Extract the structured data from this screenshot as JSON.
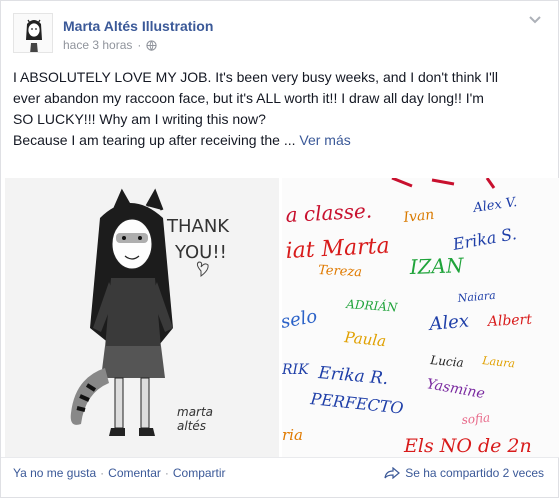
{
  "post": {
    "page_name": "Marta Altés Illustration",
    "time": "hace 3 horas",
    "line1": "I ABSOLUTELY LOVE MY JOB. It's been very busy weeks, and I don't think I'll",
    "line2": "ever abandon my raccoon face, but it's ALL worth it!! I draw all day long!! I'm",
    "line3": "SO LUCKY!!! Why am I writing this now?",
    "line4": "Because I am tearing up after receiving the ...",
    "see_more": "Ver más"
  },
  "photo_left": {
    "speech1": "THANK",
    "speech2": "YOU!!",
    "signature1": "marta",
    "signature2": "altés"
  },
  "photo_right": {
    "words": [
      {
        "text": "a classe.",
        "color": "#c8102e"
      },
      {
        "text": "Ivan",
        "color": "#d97a00"
      },
      {
        "text": "Alex V.",
        "color": "#1f3fa8"
      },
      {
        "text": "iat Marta",
        "color": "#d81b1b"
      },
      {
        "text": "Erika S.",
        "color": "#1f3fa8"
      },
      {
        "text": "IZAN",
        "color": "#1fa33a"
      },
      {
        "text": "Tereza",
        "color": "#e07a00"
      },
      {
        "text": "ADRIÁN",
        "color": "#1fa33a"
      },
      {
        "text": "Naiara",
        "color": "#1f3fa8"
      },
      {
        "text": "Alex",
        "color": "#1f3fa8"
      },
      {
        "text": "Albert",
        "color": "#d81b1b"
      },
      {
        "text": "Paula",
        "color": "#e0a000"
      },
      {
        "text": "Lucia",
        "color": "#222222"
      },
      {
        "text": "Laura",
        "color": "#e0a000"
      },
      {
        "text": "Erika R.",
        "color": "#1f3fa8"
      },
      {
        "text": "Yasmine",
        "color": "#7a2aa0"
      },
      {
        "text": "PERFECTO",
        "color": "#1f3fa8"
      },
      {
        "text": "ria",
        "color": "#e07a00"
      },
      {
        "text": "Els NO de 2n",
        "color": "#d81b1b"
      },
      {
        "text": "sofia",
        "color": "#e86a8a"
      },
      {
        "text": "selo",
        "color": "#2b62c8"
      },
      {
        "text": "RIK",
        "color": "#1f3fa8"
      }
    ]
  },
  "footer": {
    "unlike": "Ya no me gusta",
    "comment": "Comentar",
    "share": "Compartir",
    "sep": "·",
    "shares": "Se ha compartido 2 veces"
  }
}
